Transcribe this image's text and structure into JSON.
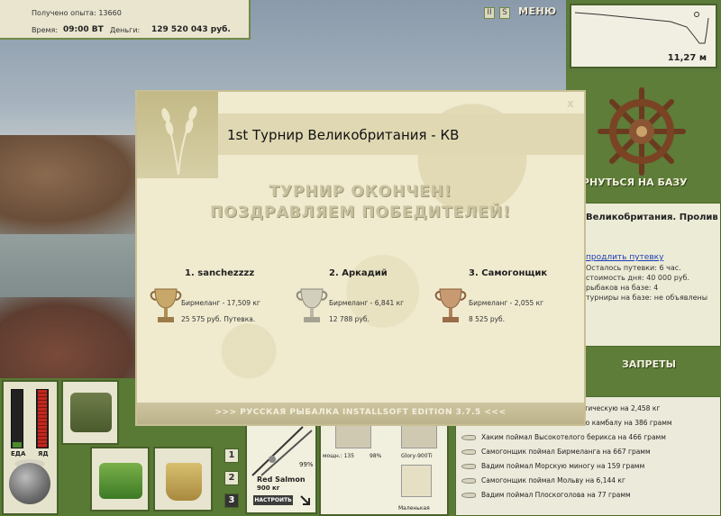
{
  "info": {
    "experience_label": "Получено опыта:",
    "experience_value": "13660",
    "time_label": "Время:",
    "time_value": "09:00 ВТ",
    "money_label": "Деньги:",
    "money_value": "129 520 043 руб."
  },
  "top_controls": {
    "pause_icon": "pause-icon",
    "settings_icon": "settings-icon",
    "menu_label": "МЕНЮ"
  },
  "depth_map": {
    "depth_value": "11,27 м"
  },
  "right_panel": {
    "back_to_base_label": "ВЕРНУТЬСЯ НА БАЗУ",
    "place_title": "Великобритания. Пролив",
    "extend_voucher": "продлить путевку",
    "lines": [
      "Осталось путевки: 6 час.",
      "стоимость дня: 40 000 руб.",
      "рыбаков на базе: 4",
      "турниры на базе: не объявлены"
    ],
    "bans_label": "ЗАПРЕТЫ"
  },
  "meters": {
    "food_label": "ЕДА",
    "poison_label": "ЯД",
    "food_level": 0.1,
    "poison_level": 1.0
  },
  "slots": {
    "numbers": [
      "1",
      "2",
      "3"
    ],
    "active": "3"
  },
  "rod": {
    "name": "Red Salmon",
    "weight": "900 кг",
    "percent": "99%",
    "setup_label": "НАСТРОИТЬ"
  },
  "tackle": {
    "reel_text": "мощн.: 135",
    "reel_pct": "98%",
    "line_text": "Glory-900Ti",
    "lure_text": "Маленькая"
  },
  "feed": {
    "items": [
      "тическую на 2,458 кг",
      "ю камбалу на 386 грамм",
      "Хаким поймал Высокотелого берикса на 466 грамм",
      "Самогонщик поймал Бирмеланга на 667 грамм",
      "Вадим поймал Морскую миногу на 159 грамм",
      "Самогонщик поймал Мольву на 6,144 кг",
      "Вадим поймал Плоскоголова на 77 грамм"
    ]
  },
  "modal": {
    "title": "1st Турнир Великобритания - КВ",
    "close_label": "x",
    "headline_1": "ТУРНИР ОКОНЧЕН!",
    "headline_2": "ПОЗДРАВЛЯЕМ ПОБЕДИТЕЛЕЙ!",
    "winners": [
      {
        "place": "1. sanchezzzz",
        "catch": "Бирмеланг - 17,509 кг",
        "prize": "25 575 руб. Путевка.",
        "cup_color": "#c8a86a"
      },
      {
        "place": "2. Аркадий",
        "catch": "Бирмеланг - 6,841 кг",
        "prize": "12 788 руб.",
        "cup_color": "#d3cfbd"
      },
      {
        "place": "3. Самогонщик",
        "catch": "Бирмеланг - 2,055 кг",
        "prize": "8 525 руб.",
        "cup_color": "#c79a72"
      }
    ],
    "footer": ">>> РУССКАЯ РЫБАЛКА INSTALLSOFT EDITION 3.7.5 <<<"
  },
  "colors": {
    "frame_green": "#5c7a3a",
    "panel_cream": "#e9e5cf",
    "modal_bg": "#f0ebcf",
    "link_blue": "#1f3cb0"
  }
}
